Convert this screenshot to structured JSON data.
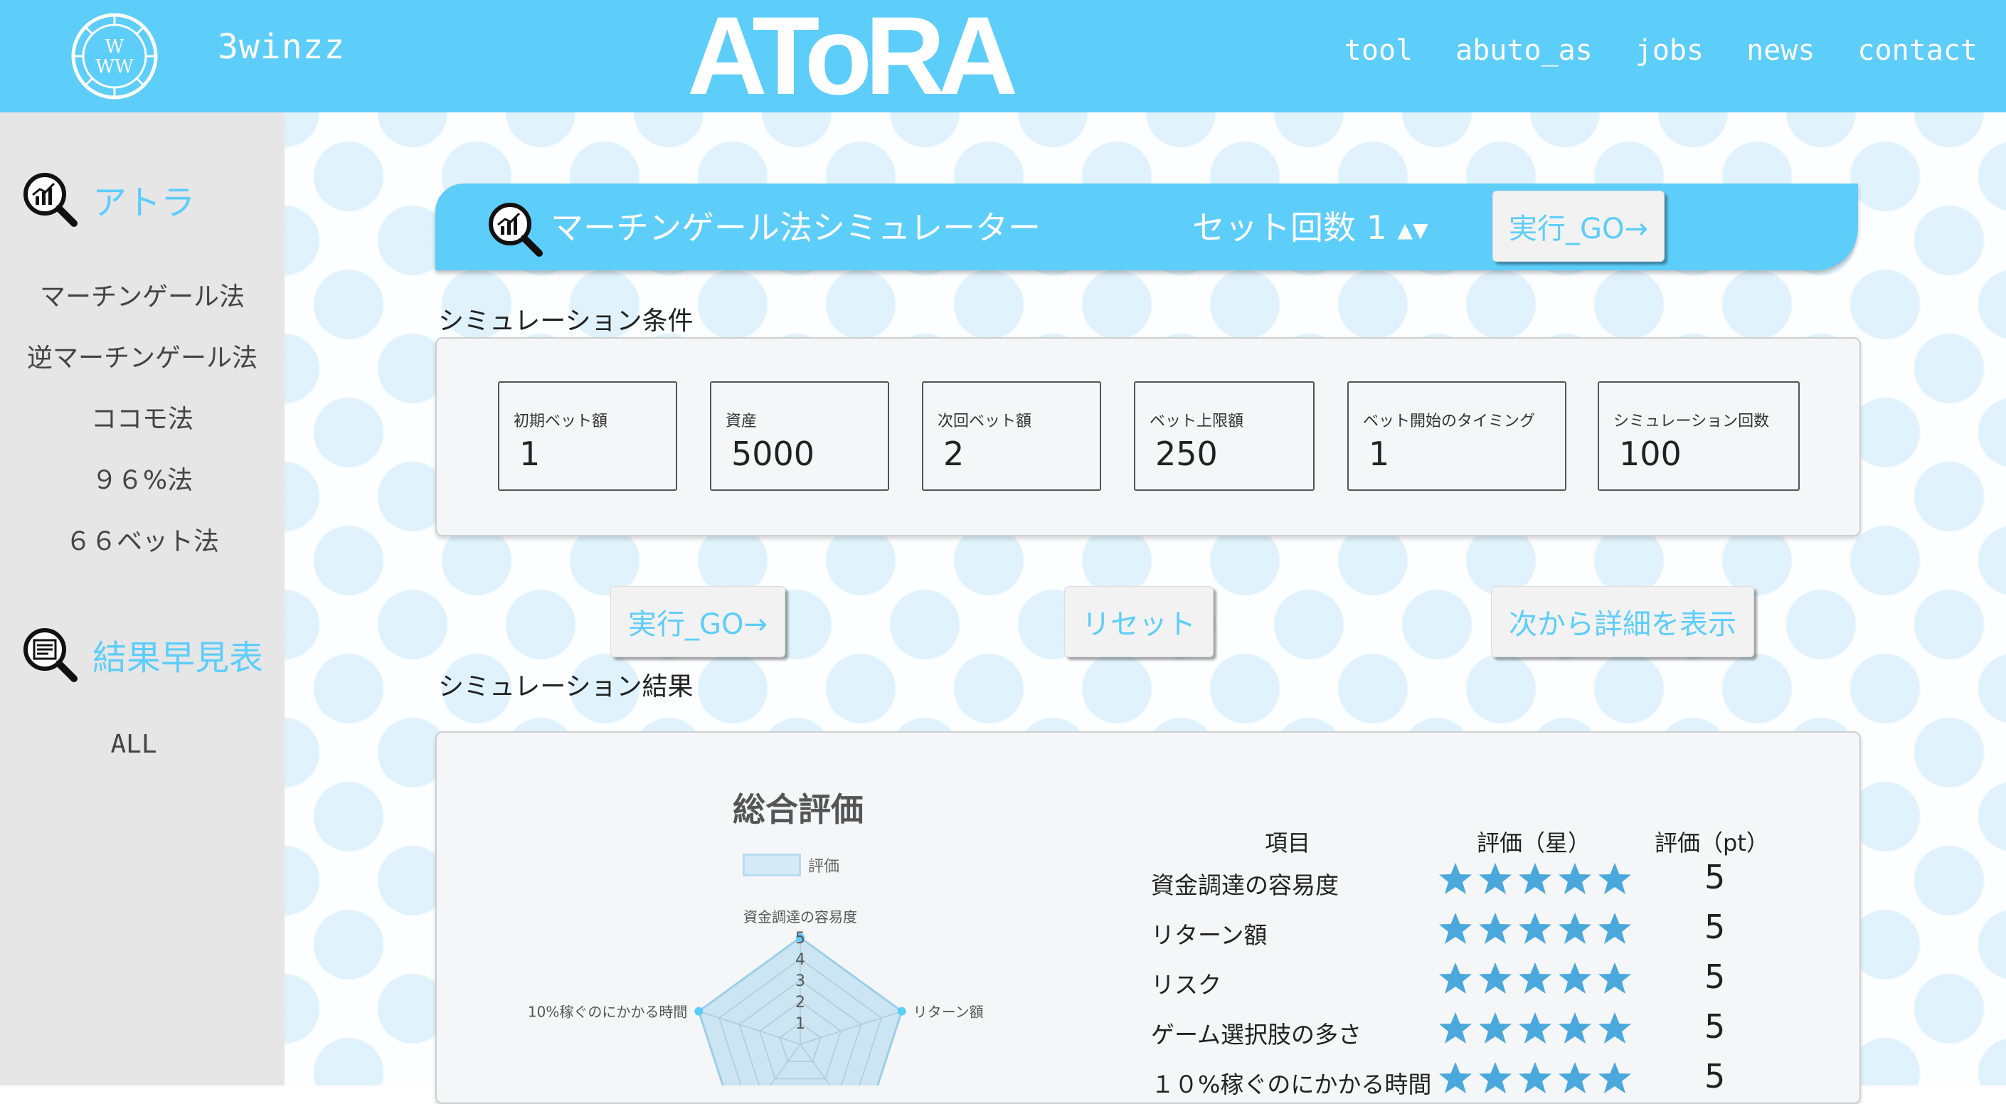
{
  "header": {
    "site_name": "3winzz",
    "brand": "AToRA",
    "nav": [
      "tool",
      "abuto_as",
      "jobs",
      "news",
      "contact"
    ]
  },
  "sidebar": {
    "sections": [
      {
        "title": "アトラ",
        "items": [
          "マーチンゲール法",
          "逆マーチンゲール法",
          "ココモ法",
          "９６%法",
          "６６ベット法"
        ]
      },
      {
        "title": "結果早見表",
        "items": [
          "ALL"
        ]
      }
    ]
  },
  "simulator": {
    "title": "マーチンゲール法シミュレーター",
    "set_count_label": "セット回数",
    "set_count_value": "1",
    "run_label": "実行_GO→"
  },
  "conditions": {
    "heading": "シミュレーション条件",
    "fields": [
      {
        "label": "初期ベット額",
        "value": "1"
      },
      {
        "label": "資産",
        "value": "5000"
      },
      {
        "label": "次回ベット額",
        "value": "2"
      },
      {
        "label": "ベット上限額",
        "value": "250"
      },
      {
        "label": "ベット開始のタイミング",
        "value": "1"
      },
      {
        "label": "シミュレーション回数",
        "value": "100"
      }
    ]
  },
  "actions": {
    "run": "実行_GO→",
    "reset": "リセット",
    "details": "次から詳細を表示"
  },
  "results": {
    "heading": "シミュレーション結果",
    "radar_title": "総合評価",
    "legend": "評価",
    "radar_axes": [
      "資金調達の容易度",
      "リターン額",
      "",
      "",
      "10%稼ぐのにかかる時間"
    ],
    "radar_ticks": [
      "1",
      "2",
      "3",
      "4",
      "5"
    ],
    "table_headers": [
      "項目",
      "評価（星）",
      "評価（pt）"
    ],
    "rows": [
      {
        "label": "資金調達の容易度",
        "stars": 5,
        "pt": "5"
      },
      {
        "label": "リターン額",
        "stars": 5,
        "pt": "5"
      },
      {
        "label": "リスク",
        "stars": 5,
        "pt": "5"
      },
      {
        "label": "ゲーム選択肢の多さ",
        "stars": 5,
        "pt": "5"
      },
      {
        "label": "１０%稼ぐのにかかる時間",
        "stars": 5,
        "pt": "5"
      }
    ]
  },
  "chart_data": {
    "type": "radar",
    "title": "総合評価",
    "categories": [
      "資金調達の容易度",
      "リターン額",
      "リスク",
      "ゲーム選択肢の多さ",
      "10%稼ぐのにかかる時間"
    ],
    "series": [
      {
        "name": "評価",
        "values": [
          5,
          5,
          5,
          5,
          5
        ]
      }
    ],
    "rlim": [
      0,
      5
    ]
  },
  "colors": {
    "accent": "#5dcdfa",
    "star": "#4aa8dd"
  }
}
